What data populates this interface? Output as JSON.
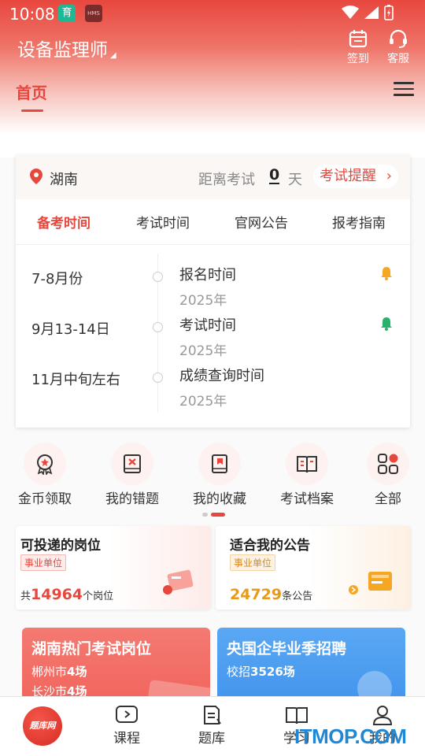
{
  "status_bar": {
    "time": "10:08",
    "app1_glyph": "育",
    "app2_glyph": "HMS"
  },
  "header": {
    "title": "设备监理师",
    "checkin_label": "签到",
    "service_label": "客服"
  },
  "tabs": {
    "home": "首页"
  },
  "exam_card": {
    "location": "湖南",
    "distance_label": "距离考试",
    "distance_days": "0",
    "distance_unit": "天",
    "remind_label": "考试提醒",
    "subtabs": [
      {
        "label": "备考时间",
        "active": true
      },
      {
        "label": "考试时间",
        "active": false
      },
      {
        "label": "官网公告",
        "active": false
      },
      {
        "label": "报考指南",
        "active": false
      }
    ],
    "timeline": [
      {
        "date": "7-8月份",
        "title": "报名时间",
        "year": "2025年",
        "bell_color": "#f5a623"
      },
      {
        "date": "9月13-14日",
        "title": "考试时间",
        "year": "2025年",
        "bell_color": "#27b36b"
      },
      {
        "date": "11月中旬左右",
        "title": "成绩查询时间",
        "year": "2025年",
        "bell_color": ""
      }
    ]
  },
  "quick_actions": [
    {
      "label": "金币领取",
      "icon": "coin-badge-icon"
    },
    {
      "label": "我的错题",
      "icon": "wrong-book-icon"
    },
    {
      "label": "我的收藏",
      "icon": "favorite-book-icon"
    },
    {
      "label": "考试档案",
      "icon": "archive-book-icon"
    },
    {
      "label": "全部",
      "icon": "all-apps-icon"
    }
  ],
  "info_cards": [
    {
      "title": "可投递的岗位",
      "tag": "事业单位",
      "prefix": "共",
      "count": "14964",
      "suffix": "个岗位",
      "count_color": "#e8473e"
    },
    {
      "title": "适合我的公告",
      "tag": "事业单位",
      "prefix": "",
      "count": "24729",
      "suffix": "条公告",
      "count_color": "#e89a1c"
    }
  ],
  "promos": [
    {
      "title": "湖南热门考试岗位",
      "line1_text": "郴州市",
      "line1_bold": "4场",
      "line2_text": "长沙市",
      "line2_bold": "4场",
      "color": "#f26b63"
    },
    {
      "title": "央国企毕业季招聘",
      "line1_text": "校招",
      "line1_bold": "3526场",
      "line2_text": "",
      "line2_bold": "",
      "color": "#4aa0f0"
    }
  ],
  "bottom_nav": {
    "logo_text": "题库网",
    "items": [
      {
        "label": "课程"
      },
      {
        "label": "题库"
      },
      {
        "label": "学习"
      },
      {
        "label": "我的"
      }
    ]
  },
  "watermark": "ITMOP.COM"
}
